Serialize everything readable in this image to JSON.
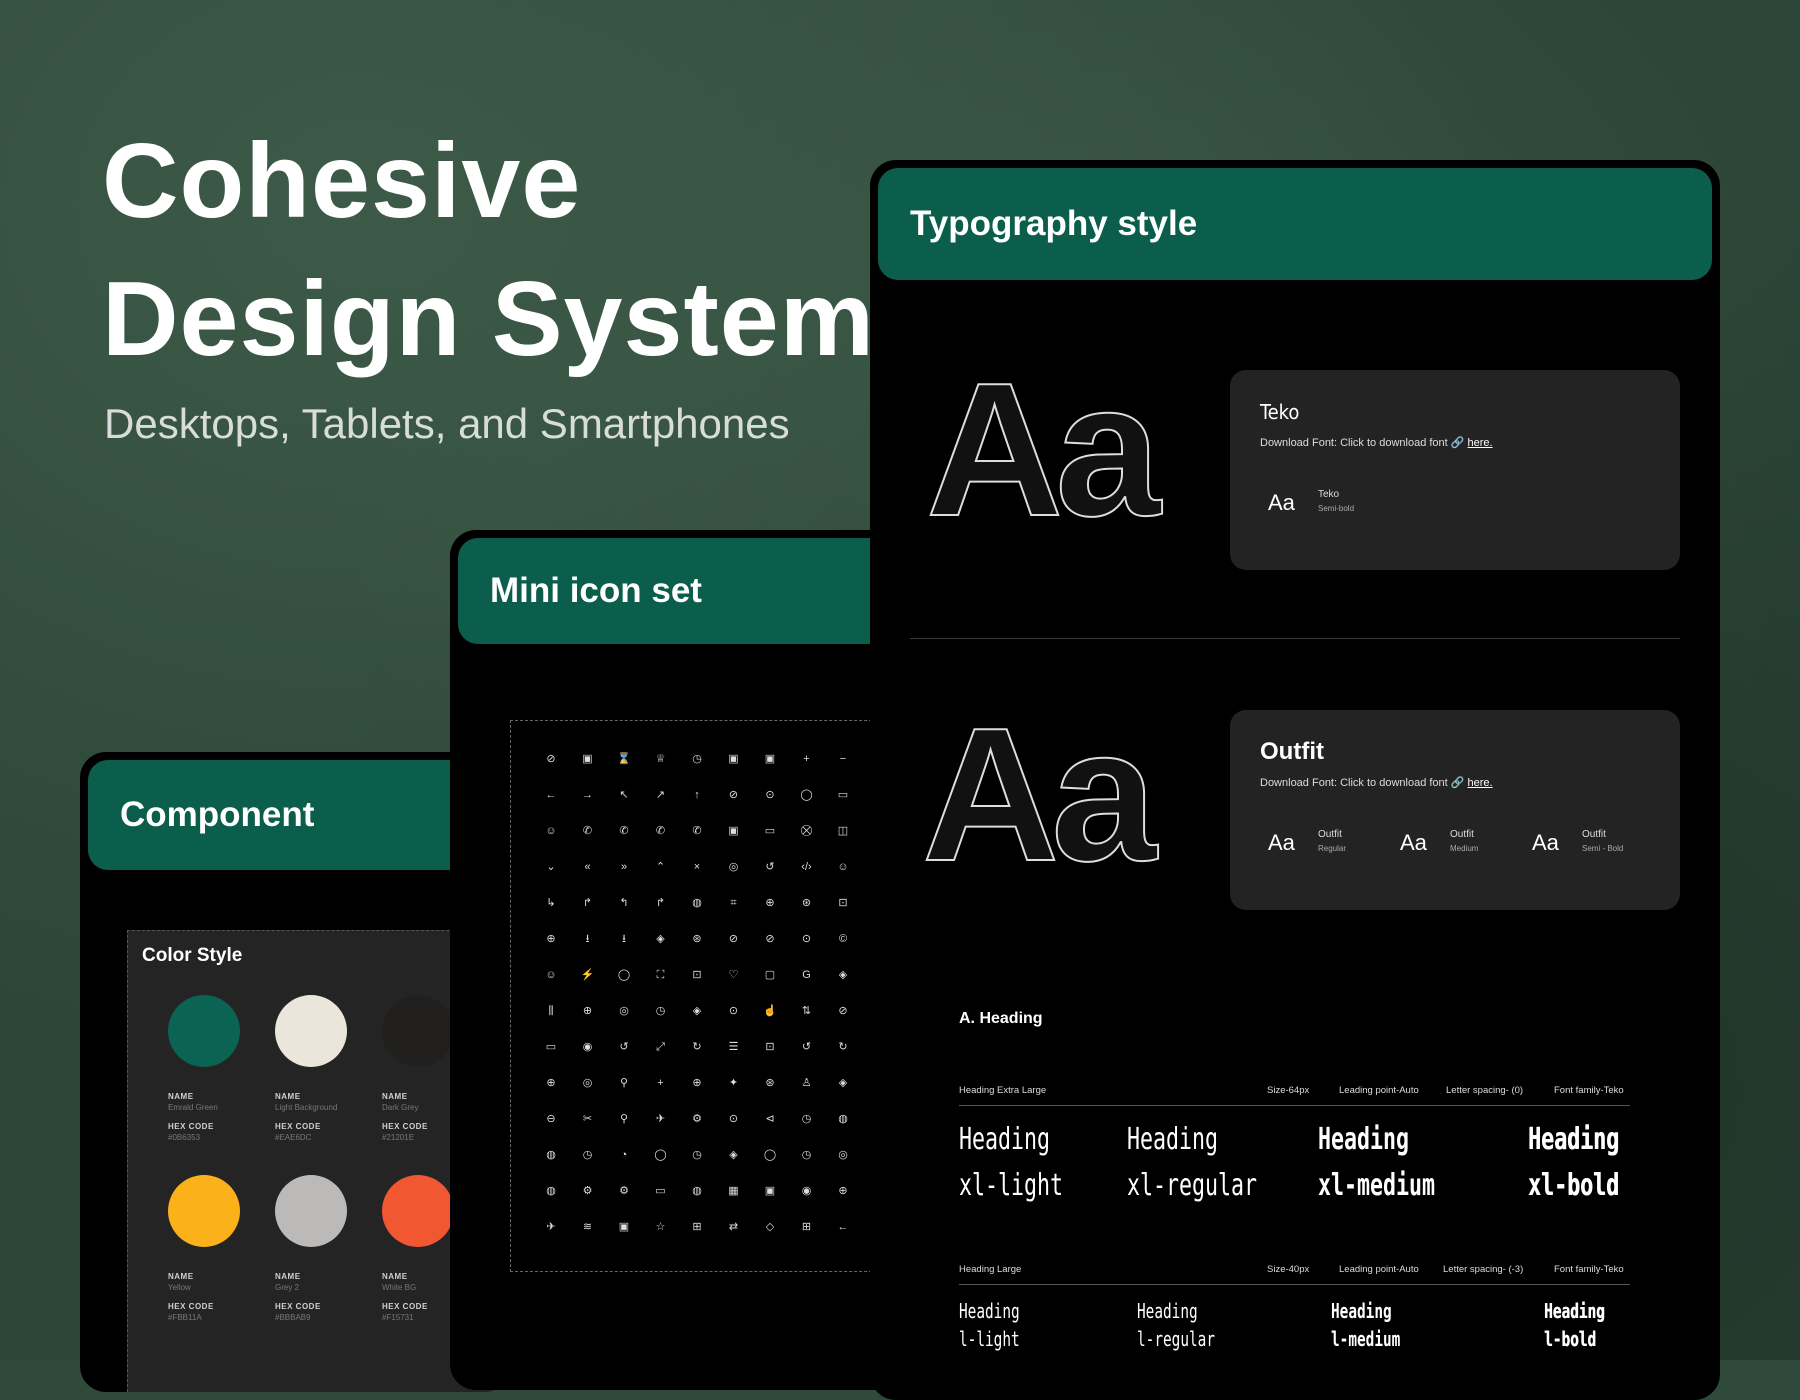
{
  "hero": {
    "title_line1": "Cohesive",
    "title_line2": "Design System",
    "subtitle": "Desktops, Tablets, and Smartphones"
  },
  "component_card": {
    "title": "Component",
    "color_style": {
      "heading": "Color Style",
      "name_label": "NAME",
      "hex_label": "HEX CODE",
      "swatches": [
        {
          "name": "Emrald Green",
          "hex": "#0B6353",
          "color": "#0b6353"
        },
        {
          "name": "Light Background",
          "hex": "#EAE6DC",
          "color": "#eae6dc"
        },
        {
          "name": "Dark Grey",
          "hex": "#21201E",
          "color": "#21201e"
        },
        {
          "name": "Yellow",
          "hex": "#FBB11A",
          "color": "#fbb11a"
        },
        {
          "name": "Grey 2",
          "hex": "#BBBAB9",
          "color": "#bbbab9"
        },
        {
          "name": "White BG",
          "hex": "#F15731",
          "color": "#f15731"
        }
      ]
    }
  },
  "icon_card": {
    "title": "Mini icon set",
    "icons": [
      "⊘",
      "▣",
      "⌛",
      "♕",
      "◷",
      "▣",
      "▣",
      "+",
      "−",
      "←",
      "→",
      "↖",
      "↗",
      "↑",
      "⊘",
      "⊙",
      "◯",
      "▭",
      "☺",
      "✆",
      "✆",
      "✆",
      "✆",
      "▣",
      "▭",
      "⛒",
      "◫",
      "⌄",
      "«",
      "»",
      "⌃",
      "×",
      "◎",
      "↺",
      "‹/›",
      "☺",
      "↳",
      "↱",
      "↰",
      "↱",
      "◍",
      "⌗",
      "⊕",
      "⊛",
      "⊡",
      "⊕",
      "⭳",
      "⭳",
      "◈",
      "⊛",
      "⊘",
      "⊘",
      "⊙",
      "©",
      "☺",
      "⚡",
      "◯",
      "⛶",
      "⊡",
      "♡",
      "▢",
      "G",
      "◈",
      "⫼",
      "⊕",
      "◎",
      "◷",
      "◈",
      "⊙",
      "☝",
      "⇅",
      "⊘",
      "▭",
      "◉",
      "↺",
      "⤢",
      "↻",
      "☰",
      "⊡",
      "↺",
      "↻",
      "⊕",
      "◎",
      "⚲",
      "+",
      "⊕",
      "✦",
      "⊛",
      "♙",
      "◈",
      "⊖",
      "✂",
      "⚲",
      "✈",
      "⚙",
      "⊙",
      "⊲",
      "◷",
      "◍",
      "◍",
      "◷",
      "◔",
      "◯",
      "◷",
      "◈",
      "◯",
      "◷",
      "◎",
      "◍",
      "⚙",
      "⚙",
      "▭",
      "◍",
      "▦",
      "▣",
      "◉",
      "⊕",
      "✈",
      "≋",
      "▣",
      "☆",
      "⊞",
      "⇄",
      "◇",
      "⊞",
      "←"
    ]
  },
  "typography_card": {
    "title": "Typography style",
    "aa": "Aa",
    "teko": {
      "name": "Teko",
      "download_text": "Download Font: Click to download font 🔗 ",
      "link": "here.",
      "sample": "Aa",
      "sample_name": "Teko",
      "sample_weight": "Semi-bold"
    },
    "outfit": {
      "name": "Outfit",
      "download_text": "Download Font: Click to download font 🔗 ",
      "link": "here.",
      "samples": [
        {
          "aa": "Aa",
          "name": "Outfit",
          "weight": "Regular"
        },
        {
          "aa": "Aa",
          "name": "Outfit",
          "weight": "Medium"
        },
        {
          "aa": "Aa",
          "name": "Outfit",
          "weight": "Semi - Bold"
        }
      ]
    },
    "section_heading": "A. Heading",
    "xl": {
      "label": "Heading Extra Large",
      "size": "Size-64px",
      "leading": "Leading point-Auto",
      "spacing": "Letter spacing- (0)",
      "family": "Font family-Teko",
      "line1": [
        "Heading",
        "Heading",
        "Heading",
        "Heading"
      ],
      "line2": [
        "xl-light",
        "xl-regular",
        "xl-medium",
        "xl-bold"
      ]
    },
    "large": {
      "label": "Heading Large",
      "size": "Size-40px",
      "leading": "Leading point-Auto",
      "spacing": "Letter spacing- (-3)",
      "family": "Font family-Teko",
      "line1": [
        "Heading",
        "Heading",
        "Heading",
        "Heading"
      ],
      "line2": [
        "l-light",
        "l-regular",
        "l-medium",
        "l-bold"
      ]
    }
  }
}
